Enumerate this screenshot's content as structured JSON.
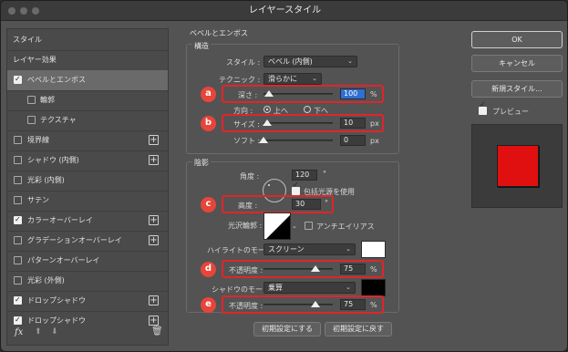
{
  "window": {
    "title": "レイヤースタイル"
  },
  "left_panel": {
    "items": [
      {
        "label": "スタイル",
        "checkbox": null,
        "plus": false,
        "selected": false,
        "indent": false
      },
      {
        "label": "レイヤー効果",
        "checkbox": null,
        "plus": false,
        "selected": false,
        "indent": false
      },
      {
        "label": "ベベルとエンボス",
        "checkbox": "on",
        "plus": false,
        "selected": true,
        "indent": false
      },
      {
        "label": "輪郭",
        "checkbox": "off",
        "plus": false,
        "selected": false,
        "indent": true
      },
      {
        "label": "テクスチャ",
        "checkbox": "off",
        "plus": false,
        "selected": false,
        "indent": true
      },
      {
        "label": "境界線",
        "checkbox": "off",
        "plus": true,
        "selected": false,
        "indent": false
      },
      {
        "label": "シャドウ (内側)",
        "checkbox": "off",
        "plus": true,
        "selected": false,
        "indent": false
      },
      {
        "label": "光彩 (内側)",
        "checkbox": "off",
        "plus": false,
        "selected": false,
        "indent": false
      },
      {
        "label": "サテン",
        "checkbox": "off",
        "plus": false,
        "selected": false,
        "indent": false
      },
      {
        "label": "カラーオーバーレイ",
        "checkbox": "on",
        "plus": true,
        "selected": false,
        "indent": false
      },
      {
        "label": "グラデーションオーバーレイ",
        "checkbox": "off",
        "plus": true,
        "selected": false,
        "indent": false
      },
      {
        "label": "パターンオーバーレイ",
        "checkbox": "off",
        "plus": false,
        "selected": false,
        "indent": false
      },
      {
        "label": "光彩 (外側)",
        "checkbox": "off",
        "plus": false,
        "selected": false,
        "indent": false
      },
      {
        "label": "ドロップシャドウ",
        "checkbox": "on",
        "plus": true,
        "selected": false,
        "indent": false
      },
      {
        "label": "ドロップシャドウ",
        "checkbox": "on",
        "plus": true,
        "selected": false,
        "indent": false
      }
    ],
    "fx_label": "fx"
  },
  "bevel": {
    "title": "ベベルとエンボス",
    "structure_title": "構造",
    "style_label": "スタイル :",
    "style_value": "ベベル (内側)",
    "technique_label": "テクニック :",
    "technique_value": "滑らかに",
    "depth_label": "深さ :",
    "depth_value": "100",
    "depth_unit": "%",
    "depth_level": 0.08,
    "direction_label": "方向 :",
    "direction_up": "上へ",
    "direction_down": "下へ",
    "size_label": "サイズ :",
    "size_value": "10",
    "size_unit": "px",
    "size_level": 0.05,
    "soften_label": "ソフト :",
    "soften_value": "0",
    "soften_unit": "px",
    "soften_level": 0.0
  },
  "shading": {
    "title": "陰影",
    "angle_label": "角度 :",
    "angle_value": "120",
    "angle_unit": "°",
    "global_light_label": "包括光源を使用",
    "altitude_label": "高度 :",
    "altitude_value": "30",
    "altitude_unit": "°",
    "gloss_label": "光沢輪郭 :",
    "antialias_label": "アンチエイリアス",
    "highlight_mode_label": "ハイライトのモード :",
    "highlight_mode_value": "スクリーン",
    "highlight_color": "#ffffff",
    "highlight_opacity_label": "不透明度 :",
    "highlight_opacity_value": "75",
    "highlight_opacity_unit": "%",
    "highlight_opacity_level": 0.75,
    "shadow_mode_label": "シャドウのモード :",
    "shadow_mode_value": "乗算",
    "shadow_color": "#000000",
    "shadow_opacity_label": "不透明度 :",
    "shadow_opacity_value": "75",
    "shadow_opacity_unit": "%",
    "shadow_opacity_level": 0.75
  },
  "buttons": {
    "make_default": "初期設定にする",
    "reset_default": "初期設定に戻す",
    "ok": "OK",
    "cancel": "キャンセル",
    "new_style": "新規スタイル...",
    "preview_label": "プレビュー"
  },
  "badges": [
    "a",
    "b",
    "c",
    "d",
    "e"
  ],
  "colors": {
    "accent_red": "#e0252b",
    "badge_red": "#e8453a",
    "preview_red": "#e01010",
    "field_highlight": "#2f6fd3"
  }
}
